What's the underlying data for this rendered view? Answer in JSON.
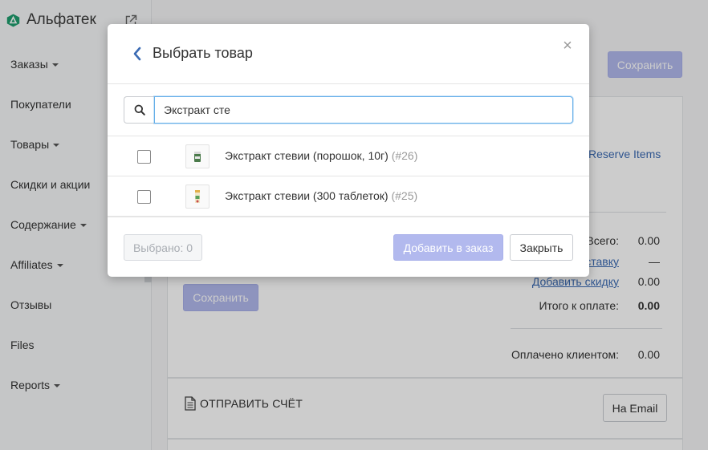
{
  "sidebar": {
    "brand_name": "Альфатек",
    "items": [
      {
        "label": "Заказы",
        "has_caret": true
      },
      {
        "label": "Покупатели",
        "has_caret": false
      },
      {
        "label": "Товары",
        "has_caret": true
      },
      {
        "label": "Скидки и акции",
        "has_caret": false
      },
      {
        "label": "Содержание",
        "has_caret": true
      },
      {
        "label": "Affiliates",
        "has_caret": true
      },
      {
        "label": "Отзывы",
        "has_caret": false
      },
      {
        "label": "Files",
        "has_caret": false
      },
      {
        "label": "Reports",
        "has_caret": true
      }
    ]
  },
  "page": {
    "save_top_label": "Сохранить",
    "reserve_items_label": "Reserve Items",
    "save_bottom_label": "Сохранить",
    "totals": {
      "total_label": "Всего:",
      "total_value": "0.00",
      "shipping_label": "доставку",
      "shipping_value": "—",
      "discount_label": "Добавить скидку",
      "discount_value": "0.00",
      "to_pay_label": "Итого к оплате:",
      "to_pay_value": "0.00",
      "paid_label": "Оплачено клиентом:",
      "paid_value": "0.00"
    },
    "invoice_title": "ОТПРАВИТЬ СЧЁТ",
    "email_button": "На Email"
  },
  "modal": {
    "title": "Выбрать товар",
    "close_symbol": "×",
    "search_value": "Экстракт сте",
    "products": [
      {
        "name": "Экстракт стевии (порошок, 10г)",
        "id": "(#26)",
        "checked": false,
        "thumb": "green-jar"
      },
      {
        "name": "Экстракт стевии (300 таблеток)",
        "id": "(#25)",
        "checked": false,
        "thumb": "tablet-bottle"
      }
    ],
    "selected_label": "Выбрано: 0",
    "add_button": "Добавить в заказ",
    "close_button": "Закрыть"
  },
  "colors": {
    "accent": "#3b6bb3",
    "primary_disabled": "#b2b9ee",
    "brand_green": "#1f9e6e",
    "focus_border": "#66afe9"
  }
}
